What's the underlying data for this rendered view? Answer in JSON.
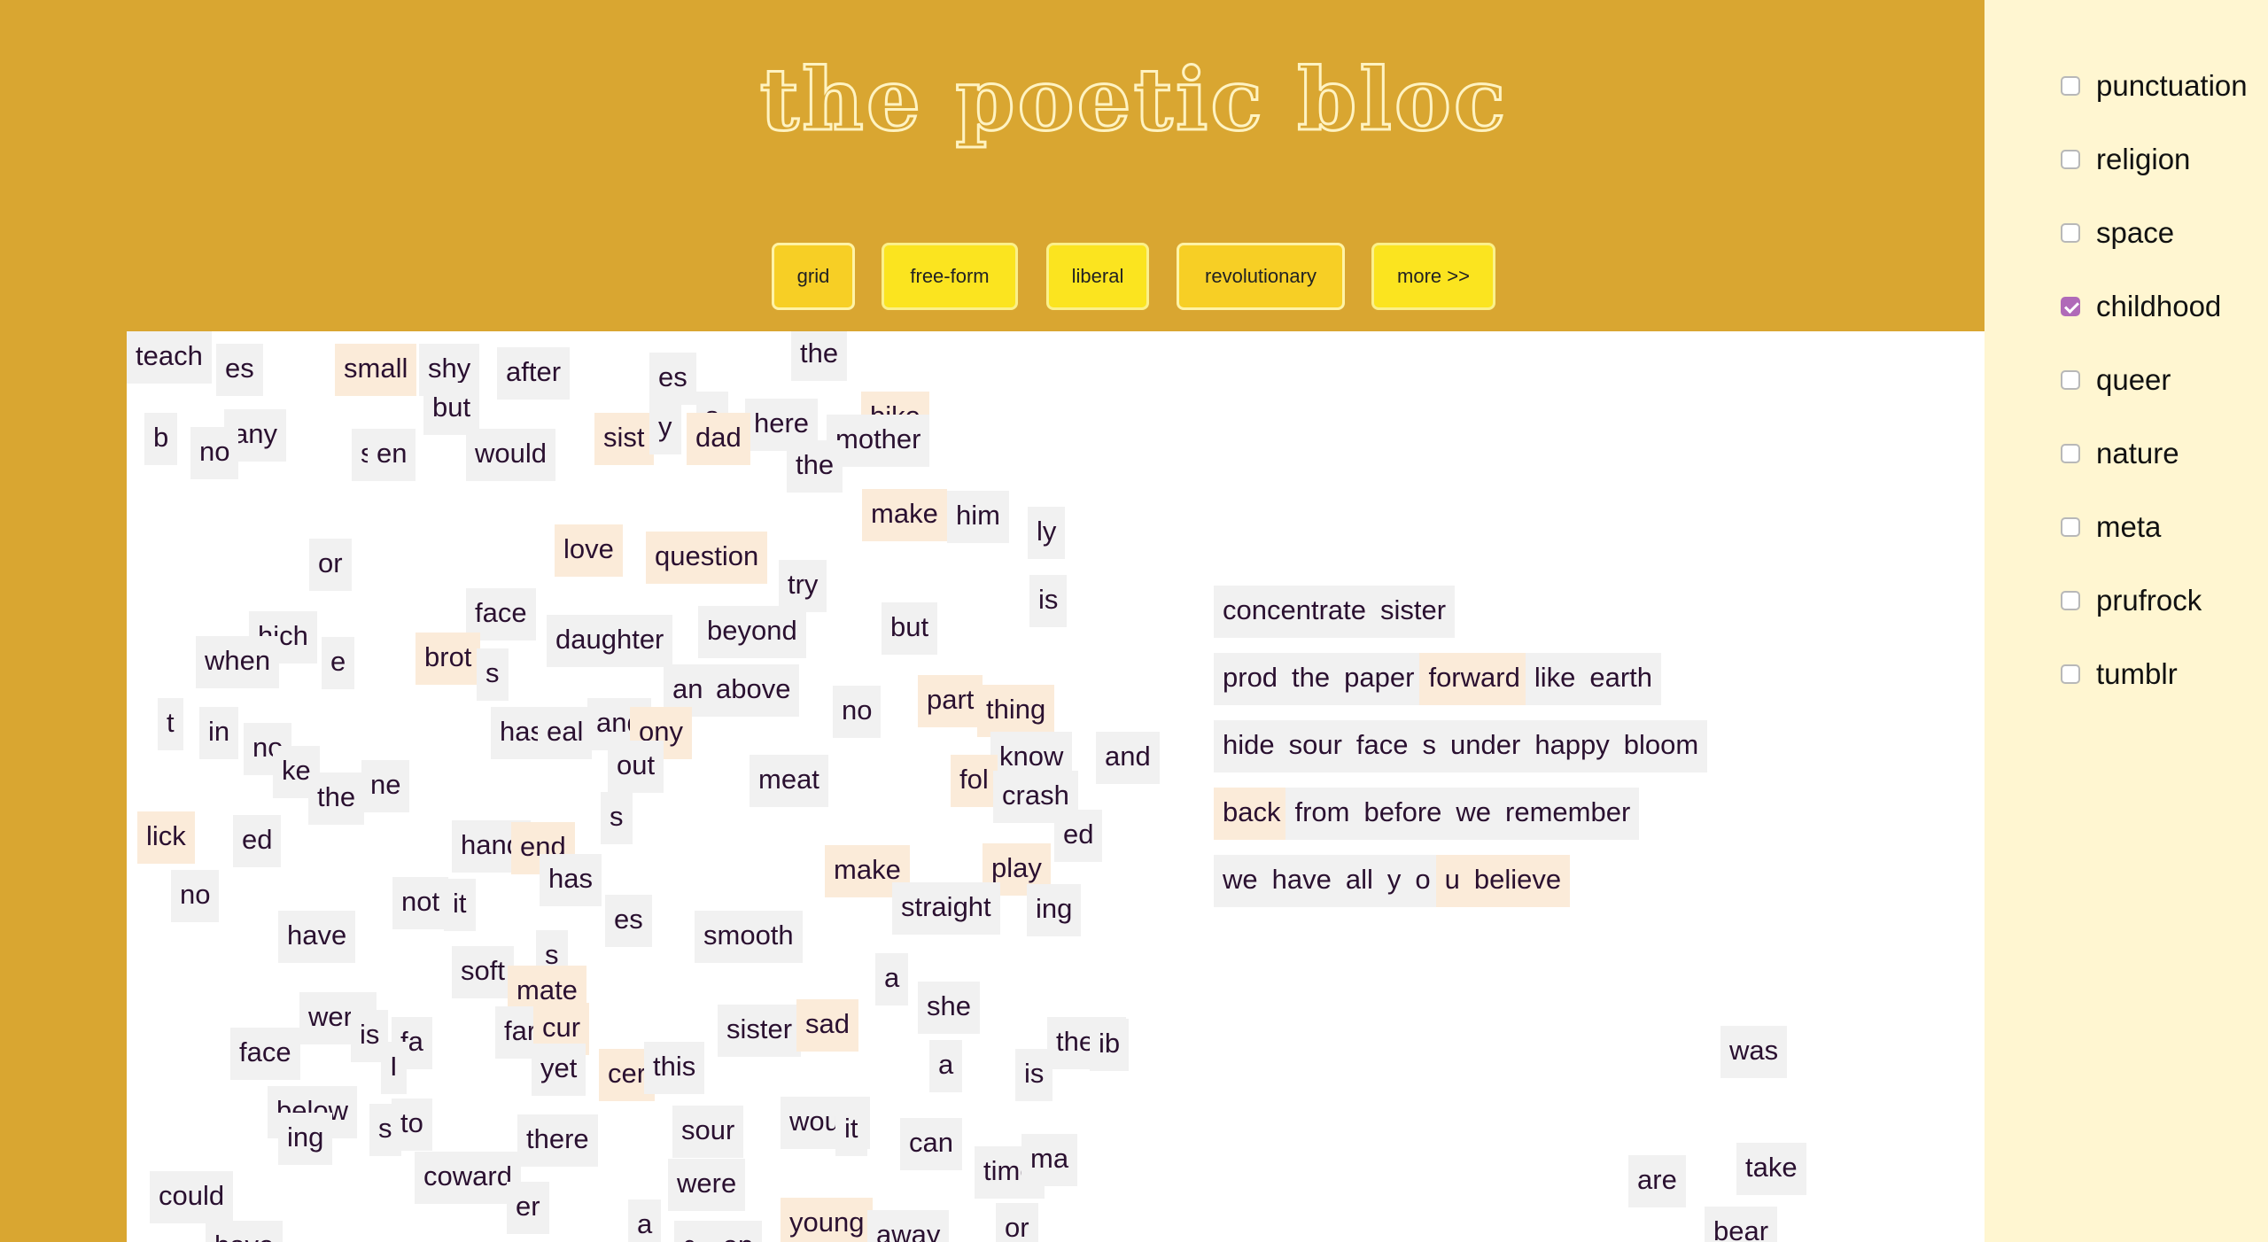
{
  "title": "the poetic bloc",
  "buttons": [
    {
      "label": "grid",
      "active": true
    },
    {
      "label": "free-form",
      "active": false
    },
    {
      "label": "liberal",
      "active": false
    },
    {
      "label": "revolutionary",
      "active": true
    },
    {
      "label": "more >>",
      "active": false
    }
  ],
  "categories": [
    {
      "label": "punctuation",
      "checked": false
    },
    {
      "label": "religion",
      "checked": false
    },
    {
      "label": "space",
      "checked": false
    },
    {
      "label": "childhood",
      "checked": true
    },
    {
      "label": "queer",
      "checked": false
    },
    {
      "label": "nature",
      "checked": false
    },
    {
      "label": "meta",
      "checked": false
    },
    {
      "label": "prufrock",
      "checked": false
    },
    {
      "label": "tumblr",
      "checked": false
    }
  ],
  "poem_lines": [
    [
      "concentrate",
      "sister"
    ],
    [
      "prod",
      "the",
      "paper",
      "forward",
      "like",
      "earth"
    ],
    [
      "hide",
      "sour",
      "face",
      "s",
      "under",
      "happy",
      "bloom"
    ],
    [
      "back",
      "from",
      "before",
      "we",
      "remember"
    ],
    [
      "we",
      "have",
      "all",
      "y",
      "o",
      "u",
      "believe"
    ]
  ],
  "poem_peach": [
    "forward",
    "back",
    "u",
    "believe"
  ],
  "words": [
    "es",
    "small",
    "shy",
    "after",
    "es",
    "the",
    "but",
    "s",
    "here",
    "bike",
    "any",
    "no",
    "b",
    "sist",
    "y",
    "dad",
    "mother",
    "sl",
    "en",
    "would",
    "the",
    "make",
    "him",
    "ly",
    "or",
    "love",
    "question",
    "try",
    "is",
    "face",
    "hich",
    "when",
    "e",
    "brot",
    "daughter",
    "beyond",
    "but",
    "s",
    "an",
    "above",
    "no",
    "part",
    "thing",
    "t",
    "in",
    "no",
    "has",
    "eal",
    "and",
    "ony",
    "out",
    "know",
    "and",
    "ke",
    "the",
    "ne",
    "meat",
    "fol",
    "crash",
    "s",
    "lick",
    "ed",
    "hand",
    "end",
    "has",
    "make",
    "play",
    "ed",
    "no",
    "have",
    "not",
    "it",
    "es",
    "straight",
    "ing",
    "smooth",
    "soft",
    "s",
    "mate",
    "a",
    "she",
    "were",
    "is",
    "fa",
    "far",
    "cur",
    "sister",
    "sad",
    "face",
    "I",
    "yet",
    "cer",
    "this",
    "a",
    "is",
    "them",
    "ib",
    "below",
    "ing",
    "s",
    "to",
    "there",
    "sour",
    "would",
    "it",
    "can",
    "coward",
    "were",
    "time",
    "ma",
    "could",
    "er",
    "a",
    "young",
    "away",
    "or",
    "have",
    "green",
    "it",
    "was",
    "take",
    "are",
    "bear",
    "teach"
  ]
}
